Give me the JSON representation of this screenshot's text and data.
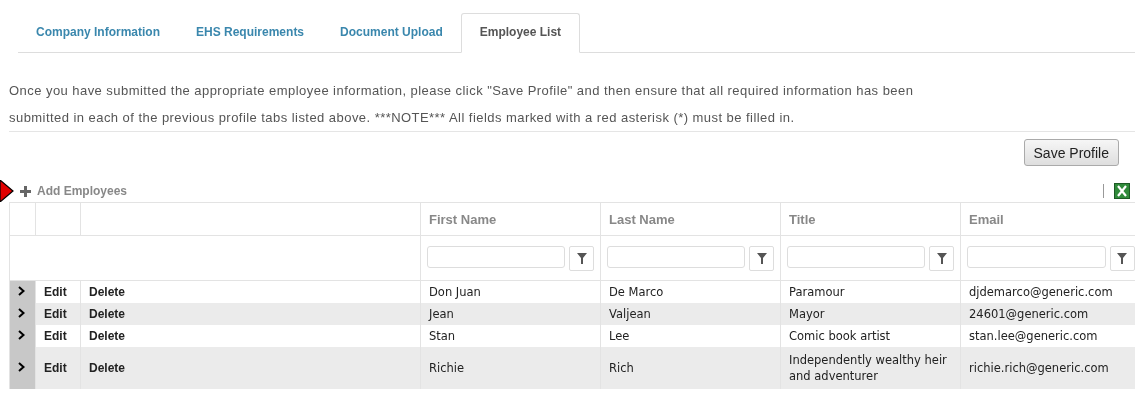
{
  "tabs": [
    {
      "label": "Company Information",
      "selected": false
    },
    {
      "label": "EHS Requirements",
      "selected": false
    },
    {
      "label": "Document Upload",
      "selected": false
    },
    {
      "label": "Employee List",
      "selected": true
    }
  ],
  "instructions": "Once you have submitted the appropriate employee information, please click \"Save Profile\" and then ensure that all required information has been submitted in each of the previous profile tabs listed above. ***NOTE*** All fields marked with a red asterisk (*) must be filled in.",
  "save_button": "Save Profile",
  "toolbar": {
    "add_label": "Add Employees"
  },
  "table": {
    "columns": [
      "First Name",
      "Last Name",
      "Title",
      "Email"
    ],
    "rows": [
      {
        "edit": "Edit",
        "delete": "Delete",
        "cells": [
          "Don Juan",
          "De Marco",
          "Paramour",
          "djdemarco@generic.com"
        ]
      },
      {
        "edit": "Edit",
        "delete": "Delete",
        "cells": [
          "Jean",
          "Valjean",
          "Mayor",
          "24601@generic.com"
        ]
      },
      {
        "edit": "Edit",
        "delete": "Delete",
        "cells": [
          "Stan",
          "Lee",
          "Comic book artist",
          "stan.lee@generic.com"
        ]
      },
      {
        "edit": "Edit",
        "delete": "Delete",
        "cells": [
          "Richie",
          "Rich",
          "Independently wealthy heir and adventurer",
          "richie.rich@generic.com"
        ]
      }
    ]
  }
}
